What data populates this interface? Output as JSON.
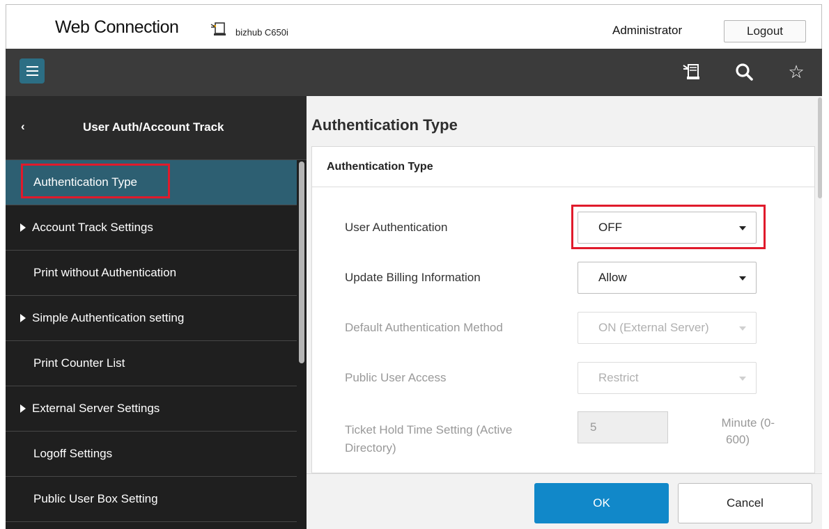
{
  "header": {
    "brand": "Web Connection",
    "model_name": "bizhub C650i",
    "user": "Administrator",
    "logout_label": "Logout"
  },
  "toolbar": {
    "icons": [
      "menu-icon",
      "printer-icon",
      "search-icon",
      "star-icon"
    ],
    "star_glyph": "☆"
  },
  "sidebar": {
    "back_glyph": "‹",
    "title": "User Auth/Account Track",
    "items": [
      {
        "label": "Authentication Type",
        "active": true,
        "expandable": false
      },
      {
        "label": "Account Track Settings",
        "active": false,
        "expandable": true
      },
      {
        "label": "Print without Authentication",
        "active": false,
        "expandable": false
      },
      {
        "label": "Simple Authentication setting",
        "active": false,
        "expandable": true
      },
      {
        "label": "Print Counter List",
        "active": false,
        "expandable": false
      },
      {
        "label": "External Server Settings",
        "active": false,
        "expandable": true
      },
      {
        "label": "Logoff Settings",
        "active": false,
        "expandable": false
      },
      {
        "label": "Public User Box Setting",
        "active": false,
        "expandable": false
      }
    ]
  },
  "main": {
    "page_title": "Authentication Type",
    "panel_title": "Authentication Type",
    "fields": {
      "user_auth": {
        "label": "User Authentication",
        "value": "OFF"
      },
      "billing": {
        "label": "Update Billing Information",
        "value": "Allow"
      },
      "default_method": {
        "label": "Default Authentication Method",
        "value": "ON (External Server)"
      },
      "public_access": {
        "label": "Public User Access",
        "value": "Restrict"
      },
      "ticket_hold": {
        "label_line1": "Ticket Hold Time Setting (Active",
        "label_line2": "Directory)",
        "value": "5",
        "unit_line1": "Minute (0-",
        "unit_line2": "600)"
      }
    },
    "ok_label": "OK",
    "cancel_label": "Cancel"
  },
  "colors": {
    "accent": "#1188c9",
    "sidebar_active": "#2d5f72",
    "highlight": "#e01a2b",
    "toolbar": "#3b3b3b"
  }
}
